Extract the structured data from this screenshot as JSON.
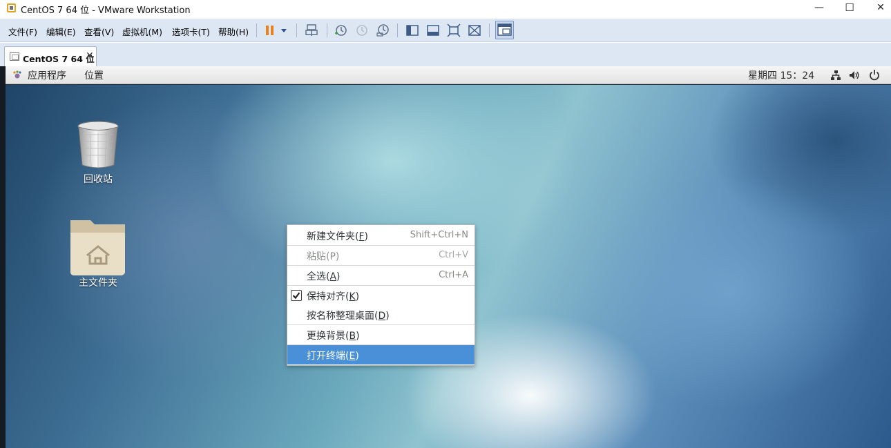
{
  "window": {
    "title": "CentOS 7 64 位 - VMware Workstation",
    "minimize": "—",
    "maximize": "☐",
    "close": "✕"
  },
  "menubar": {
    "items": [
      {
        "label": "文件(F)"
      },
      {
        "label": "编辑(E)"
      },
      {
        "label": "查看(V)"
      },
      {
        "label": "虚拟机(M)"
      },
      {
        "label": "选项卡(T)"
      },
      {
        "label": "帮助(H)"
      }
    ],
    "toolbar_icons": [
      "pause-icon",
      "dropdown-arrow-icon",
      "send-ctrl-alt-del-icon",
      "snapshot-icon",
      "revert-snapshot-icon",
      "snapshot-manager-icon",
      "library-icon",
      "console-view-icon",
      "fullscreen-icon",
      "unity-icon",
      "view-tabs-icon"
    ]
  },
  "tab": {
    "label": "CentOS 7 64 位",
    "close": "✕"
  },
  "gnome": {
    "applications": "应用程序",
    "places": "位置",
    "clock": "星期四 15：24"
  },
  "desktop": {
    "icons": [
      {
        "label": "回收站"
      },
      {
        "label": "主文件夹"
      }
    ]
  },
  "context_menu": {
    "items": [
      {
        "label": "新建文件夹(F)",
        "mnemonic": "F",
        "accel": "Shift+Ctrl+N",
        "state": "normal"
      },
      {
        "label": "粘贴(P)",
        "accel": "Ctrl+V",
        "state": "disabled"
      },
      {
        "label": "全选(A)",
        "mnemonic": "A",
        "accel": "Ctrl+A",
        "state": "normal"
      },
      {
        "label": "保持对齐(K)",
        "mnemonic": "K",
        "accel": "",
        "state": "checked"
      },
      {
        "label": "按名称整理桌面(D)",
        "mnemonic": "D",
        "accel": "",
        "state": "normal"
      },
      {
        "label": "更换背景(B)",
        "mnemonic": "B",
        "accel": "",
        "state": "normal"
      },
      {
        "label": "打开终端(E)",
        "mnemonic": "E",
        "accel": "",
        "state": "highlighted"
      }
    ]
  },
  "colors": {
    "menubar_bg": "#dde6f3",
    "highlight": "#4a90d9",
    "pause_orange": "#e8821e"
  }
}
